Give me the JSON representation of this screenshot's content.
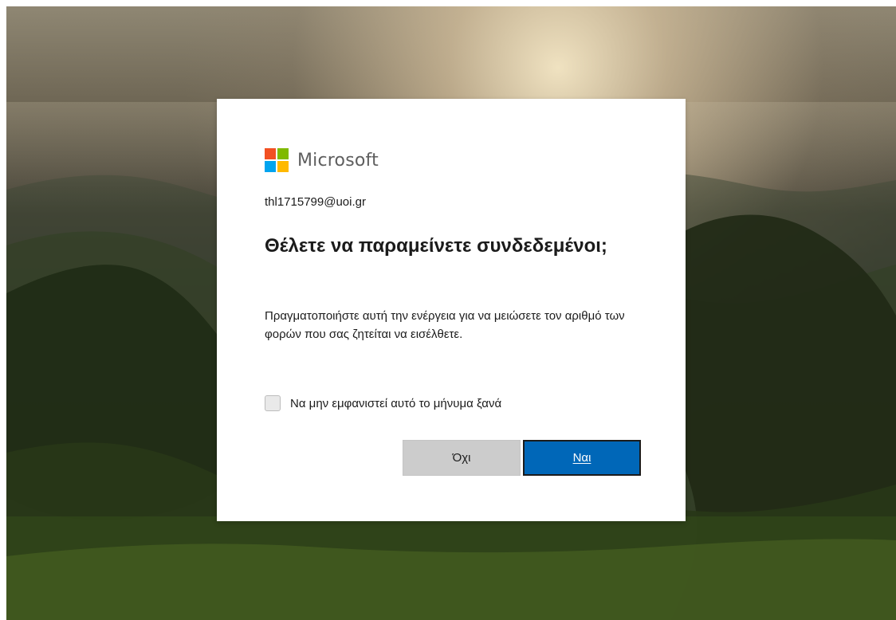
{
  "brand": {
    "name": "Microsoft",
    "logo_colors": [
      "#f25022",
      "#7fba00",
      "#00a4ef",
      "#ffb900"
    ],
    "text_color": "#5e5e5e"
  },
  "dialog": {
    "account": "thl1715799@uoi.gr",
    "title": "Θέλετε να παραμείνετε συνδεδεμένοι;",
    "description": "Πραγματοποιήστε αυτή την ενέργεια για να μειώσετε τον αριθμό των φορών που σας ζητείται να εισέλθετε.",
    "checkbox_label": "Να μην εμφανιστεί αυτό το μήνυμα ξανά",
    "buttons": {
      "no": "Όχι",
      "yes": "Ναι"
    }
  },
  "colors": {
    "primary_button": "#0067b8",
    "secondary_button": "#cccccc",
    "dialog_background": "#ffffff"
  }
}
